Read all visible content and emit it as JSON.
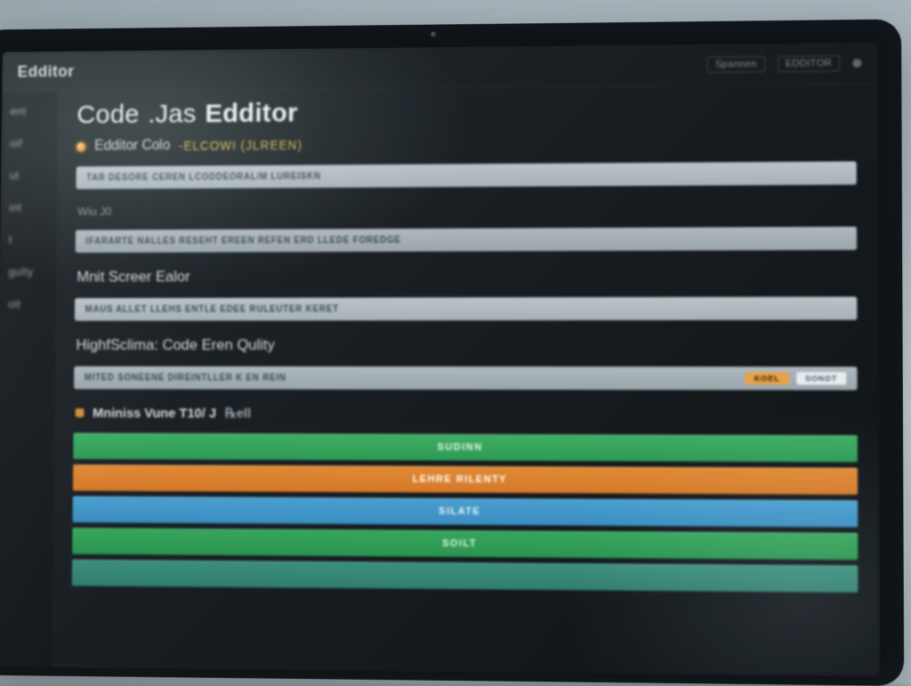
{
  "window": {
    "tab_label": "Edditor",
    "top_tag": "Spannen",
    "top_tag2": "EDDITOR"
  },
  "sidebar": {
    "items": [
      {
        "label": "ent"
      },
      {
        "label": "oif"
      },
      {
        "label": "ut"
      },
      {
        "label": "int"
      },
      {
        "label": "t"
      },
      {
        "label": "gulty"
      },
      {
        "label": "oit"
      }
    ]
  },
  "header": {
    "pre": "Code",
    "mid": ".Jas",
    "title": "Edditor"
  },
  "subheader": {
    "label": "Edditor Colo",
    "code": "-ELCOWI (JLREEN)"
  },
  "rows": {
    "r1": "TAR DESORE CEREN LCODDEORAL/M LUREISKN",
    "r2_label": "Wiu J0",
    "r2": "IFARARTE NALLES RESEHT EREEN REFEN ERD LLEDE  FOREDGE",
    "r3_label": "Mnit Screer Ealor",
    "r3": "MAUS ALLET LLEHS ENTLE EDEE RULEUTER KERET",
    "r4_label": "HighfSclima: Code Eren Qulity",
    "r4": "MITED SONEENE DIREINTLLER K EN REIN",
    "r4_chip1": "KOEL",
    "r4_chip2": "SONDT",
    "r5_prefix": "Mniniss Vune T10/ J",
    "r5_suffix": "℞ell"
  },
  "bars": [
    {
      "color": "green",
      "label": "SUDINN"
    },
    {
      "color": "orange",
      "label": "LEHRE RILENTY"
    },
    {
      "color": "blue",
      "label": "SILATE"
    },
    {
      "color": "green2",
      "label": "SOILT"
    },
    {
      "color": "teal",
      "label": ""
    }
  ]
}
